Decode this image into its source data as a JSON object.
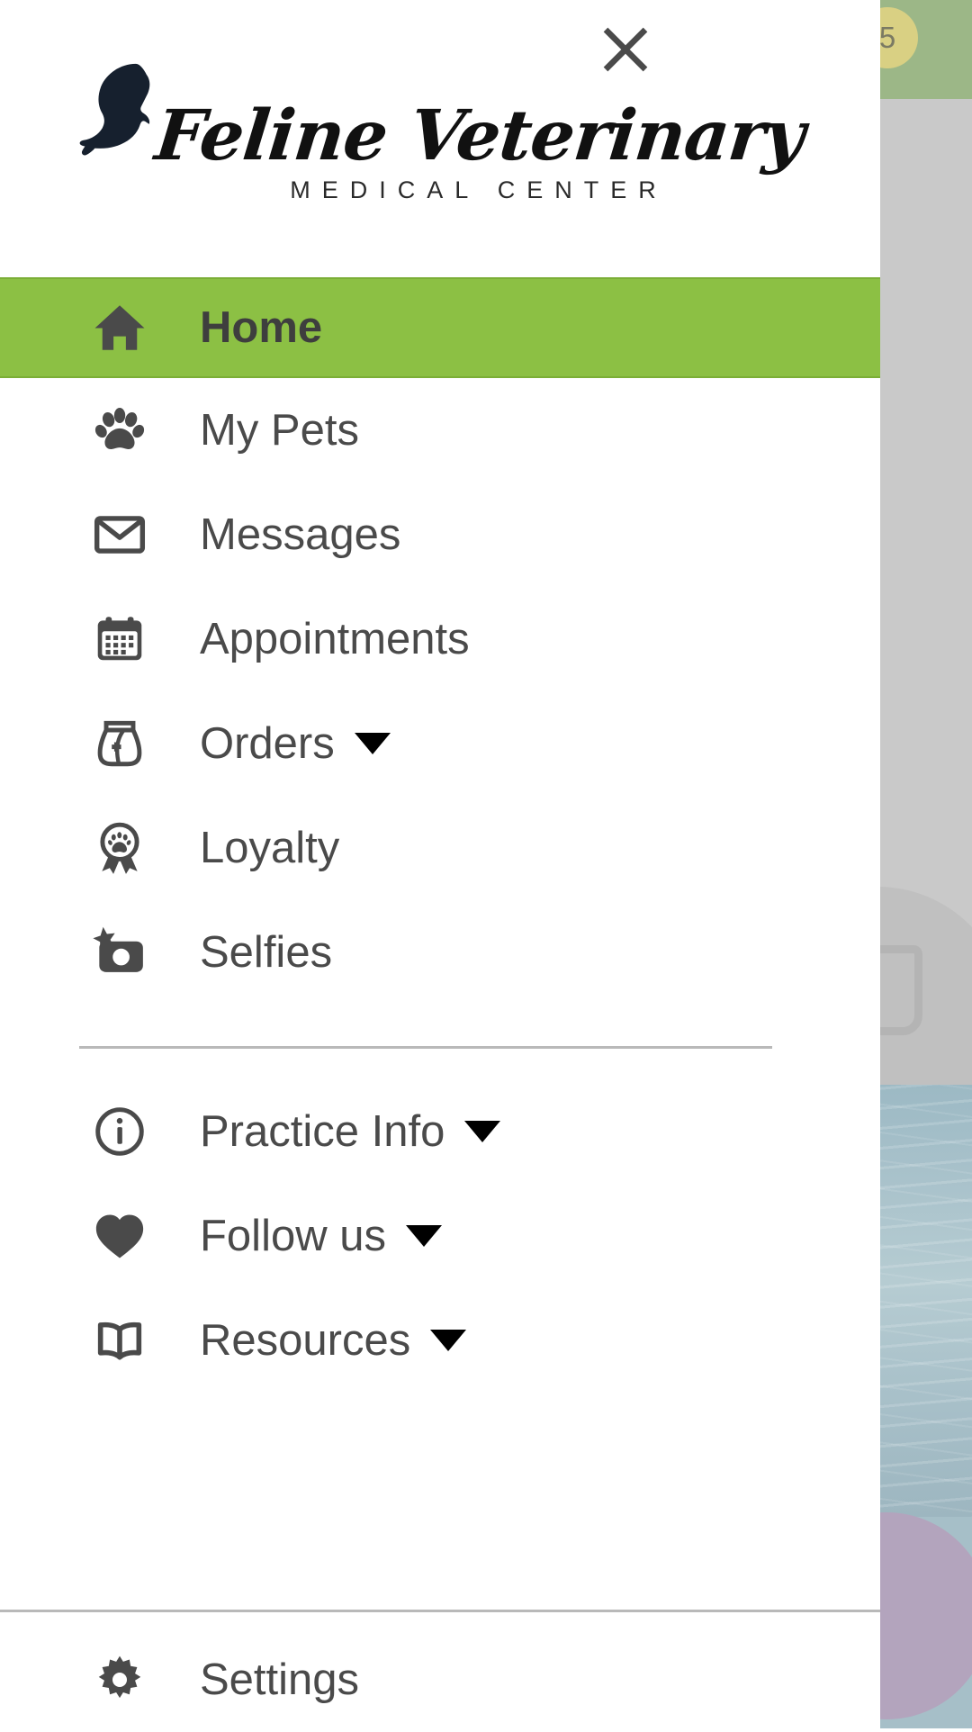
{
  "colors": {
    "active_green": "#8cc044",
    "text_gray": "#4a4a4a",
    "divider": "#b9b9b9",
    "bg_header_green": "#9cb787",
    "badge_yellow": "#d9d083"
  },
  "drawer": {
    "close_label": "Close",
    "logo": {
      "wordmark": "Feline Veterinary",
      "subtitle": "MEDICAL CENTER",
      "cat_icon": "cat-silhouette-icon"
    },
    "primary_items": [
      {
        "label": "Home",
        "icon": "home-icon",
        "active": true,
        "has_caret": false
      },
      {
        "label": "My Pets",
        "icon": "paw-icon",
        "active": false,
        "has_caret": false
      },
      {
        "label": "Messages",
        "icon": "envelope-icon",
        "active": false,
        "has_caret": false
      },
      {
        "label": "Appointments",
        "icon": "calendar-icon",
        "active": false,
        "has_caret": false
      },
      {
        "label": "Orders",
        "icon": "food-bag-icon",
        "active": false,
        "has_caret": true
      },
      {
        "label": "Loyalty",
        "icon": "award-paw-icon",
        "active": false,
        "has_caret": false
      },
      {
        "label": "Selfies",
        "icon": "camera-star-icon",
        "active": false,
        "has_caret": false
      }
    ],
    "secondary_items": [
      {
        "label": "Practice Info",
        "icon": "info-circle-icon",
        "has_caret": true
      },
      {
        "label": "Follow us",
        "icon": "heart-icon",
        "has_caret": true
      },
      {
        "label": "Resources",
        "icon": "book-icon",
        "has_caret": true
      }
    ],
    "footer_items": [
      {
        "label": "Settings",
        "icon": "gear-icon"
      }
    ]
  },
  "background_app": {
    "message_badge_count": "5",
    "envelope_icon": "envelope-icon"
  }
}
